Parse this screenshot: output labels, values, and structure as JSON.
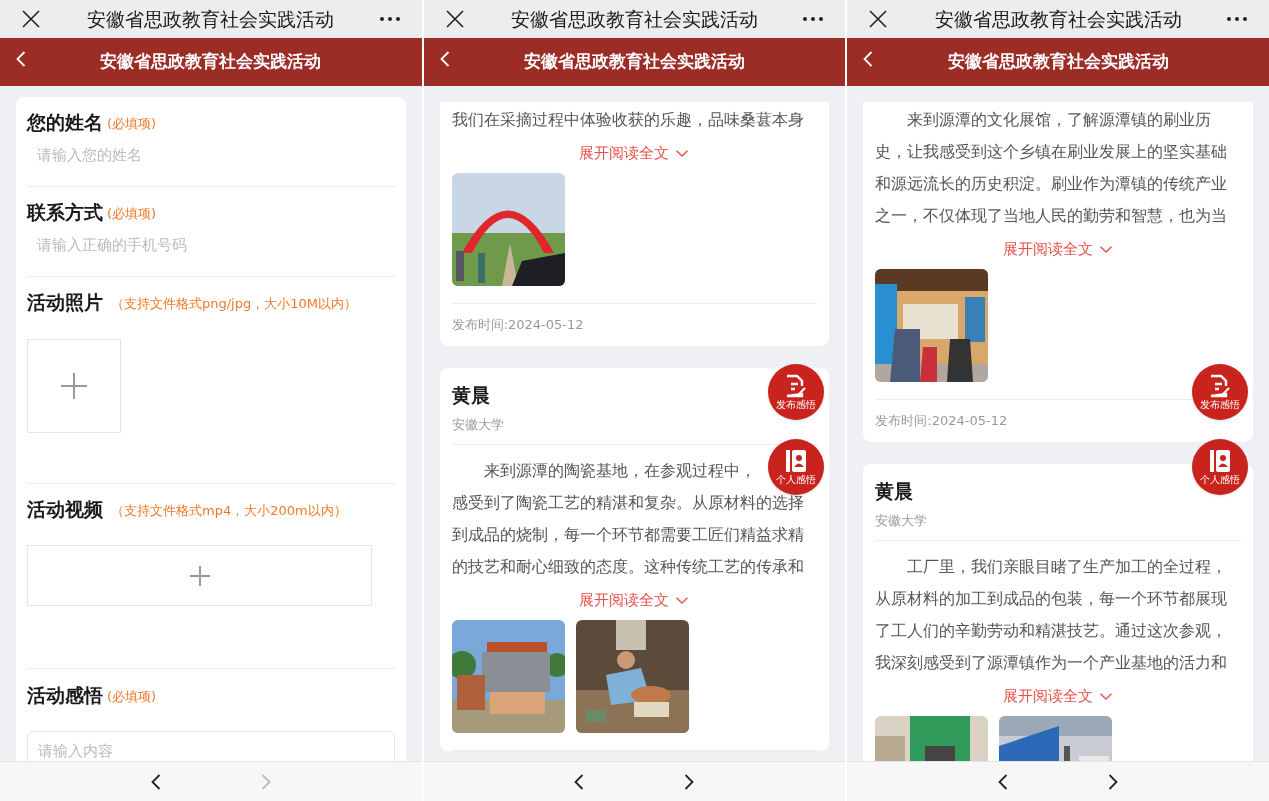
{
  "panels": [
    {
      "top_bar": {
        "title": "安徽省思政教育社会实践活动"
      },
      "header": {
        "title": "安徽省思政教育社会实践活动"
      },
      "form": {
        "fields": [
          {
            "kind": "text",
            "label": "您的姓名",
            "note": "(必填项)",
            "placeholder": "请输入您的姓名"
          },
          {
            "kind": "text",
            "label": "联系方式",
            "note": "(必填项)",
            "placeholder": "请输入正确的手机号码"
          },
          {
            "label": "活动照片",
            "note": "（支持文件格式png/jpg，大小10M以内）"
          },
          {
            "kind": "video",
            "label": "活动视频",
            "note": "（支持文件格式mp4，大小200m以内）"
          },
          {
            "kind": "textarea",
            "label": "活动感悟",
            "note": "(必填项)",
            "placeholder": "请输入内容"
          }
        ]
      },
      "nav": {
        "back_disabled": false,
        "forward_disabled": true
      }
    },
    {
      "top_bar": {
        "title": "安徽省思政教育社会实践活动"
      },
      "header": {
        "title": "安徽省思政教育社会实践活动"
      },
      "posts": [
        {
          "cut_top": true,
          "indent_first": false,
          "lines": [
            "我们在采摘过程中体验收获的乐趣，品味桑葚本身"
          ],
          "expand": "展开阅读全文",
          "images": [
            {
              "kind": "picture"
            }
          ],
          "time": "发布时间:2024-05-12"
        },
        {
          "cut_top": false,
          "author": "黄晨",
          "school": "安徽大学",
          "indent_first": true,
          "lines": [
            "来到源潭的陶瓷基地，在参观过程中，",
            "感受到了陶瓷工艺的精湛和复杂。从原材料的选择",
            "到成品的烧制，每一个环节都需要工匠们精益求精",
            "的技艺和耐心细致的态度。这种传统工艺的传承和"
          ],
          "expand": "展开阅读全文",
          "images": [
            {
              "kind": "picture"
            },
            {
              "kind": "picture"
            }
          ]
        }
      ],
      "fabs": [
        {
          "kind": "post",
          "label": "发布感悟"
        },
        {
          "kind": "profile",
          "label": "个人感悟"
        }
      ],
      "nav": {
        "back_disabled": false,
        "forward_disabled": false
      }
    },
    {
      "top_bar": {
        "title": "安徽省思政教育社会实践活动"
      },
      "header": {
        "title": "安徽省思政教育社会实践活动"
      },
      "posts": [
        {
          "cut_top": true,
          "indent_first": true,
          "lines": [
            "来到源潭的文化展馆，了解源潭镇的刷业历",
            "史，让我感受到这个乡镇在刷业发展上的坚实基础",
            "和源远流长的历史积淀。刷业作为潭镇的传统产业",
            "之一，不仅体现了当地人民的勤劳和智慧，也为当"
          ],
          "expand": "展开阅读全文",
          "images": [
            {
              "kind": "picture"
            }
          ],
          "time": "发布时间:2024-05-12"
        },
        {
          "cut_top": false,
          "author": "黄晨",
          "school": "安徽大学",
          "indent_first": true,
          "lines": [
            "工厂里，我们亲眼目睹了生产加工的全过程，",
            "从原材料的加工到成品的包装，每一个环节都展现",
            "了工人们的辛勤劳动和精湛技艺。通过这次参观，",
            "我深刻感受到了源潭镇作为一个产业基地的活力和"
          ],
          "expand": "展开阅读全文",
          "images": [
            {
              "kind": "picture"
            },
            {
              "kind": "picture"
            }
          ]
        }
      ],
      "fabs": [
        {
          "kind": "post",
          "label": "发布感悟"
        },
        {
          "kind": "profile",
          "label": "个人感悟"
        }
      ],
      "nav": {
        "back_disabled": false,
        "forward_disabled": false
      }
    }
  ]
}
